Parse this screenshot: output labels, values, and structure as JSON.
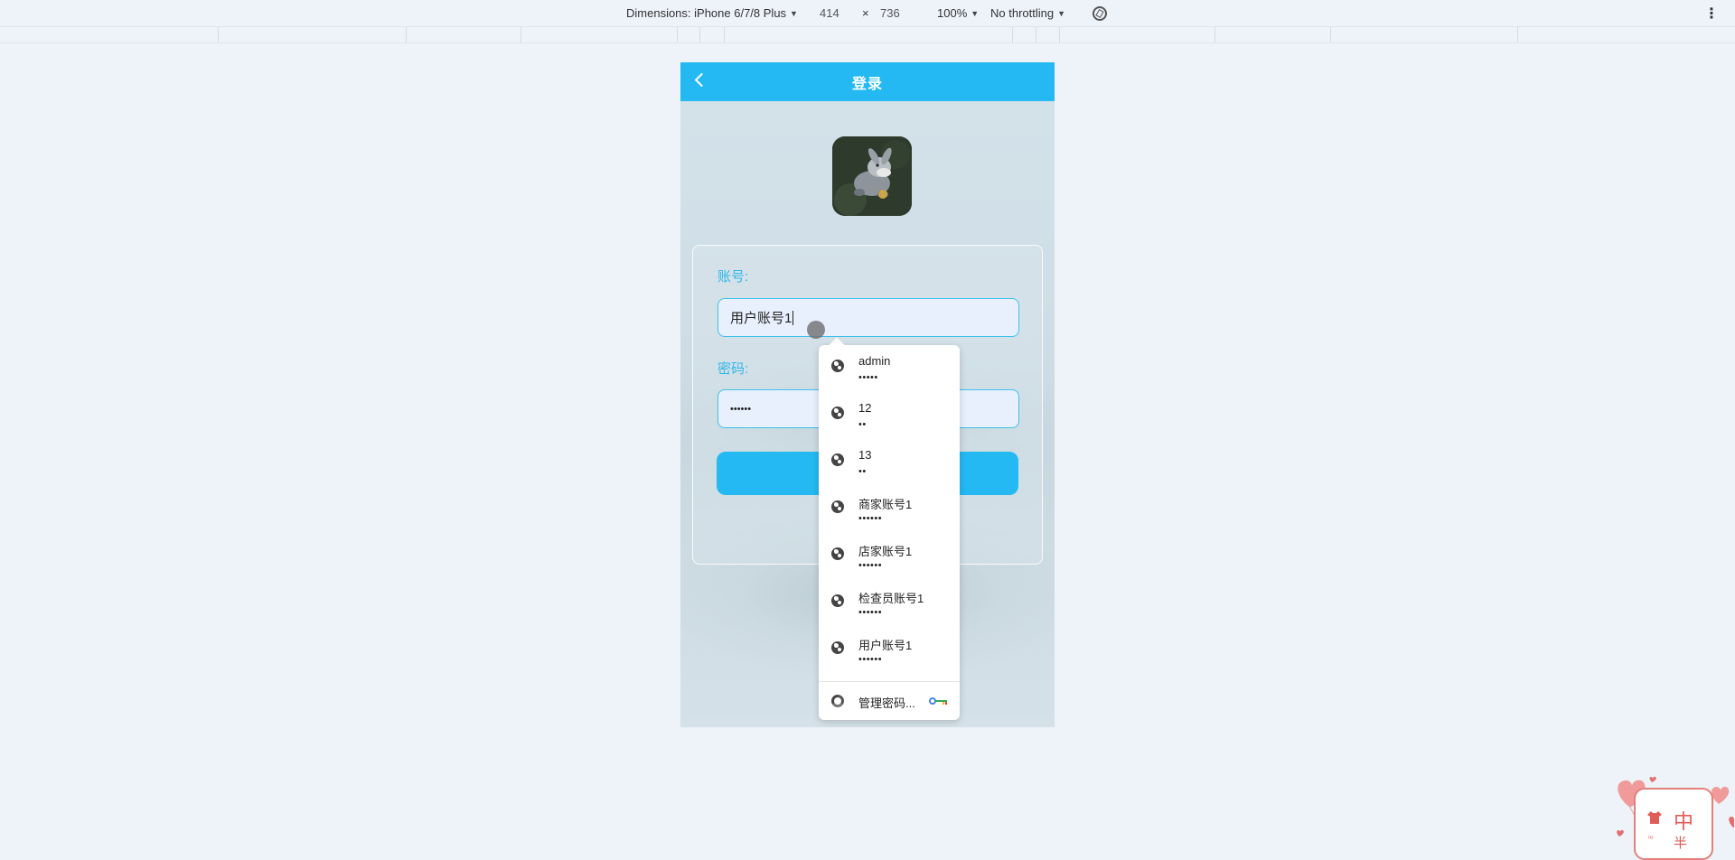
{
  "devtools": {
    "dimensions_label": "Dimensions: iPhone 6/7/8 Plus",
    "width": "414",
    "times": "×",
    "height": "736",
    "zoom": "100%",
    "throttling": "No throttling",
    "more_icon": "⋮"
  },
  "app": {
    "header_title": "登录",
    "account_label": "账号:",
    "account_value": "用户账号1",
    "password_label": "密码:",
    "password_value": "••••••"
  },
  "autofill": {
    "items": [
      {
        "username": "admin",
        "password": "•••••"
      },
      {
        "username": "12",
        "password": "••"
      },
      {
        "username": "13",
        "password": "••"
      },
      {
        "username": "商家账号1",
        "password": "••••••"
      },
      {
        "username": "店家账号1",
        "password": "••••••"
      },
      {
        "username": "检查员账号1",
        "password": "••••••"
      },
      {
        "username": "用户账号1",
        "password": "••••••"
      }
    ],
    "manage_label": "管理密码..."
  },
  "ime": {
    "char_main": "中",
    "char_sub": "半",
    "char_small": "ⁱᵒ"
  },
  "colors": {
    "accent": "#24b9f2",
    "label": "#2fb6ea",
    "input_bg": "#e8f0fe",
    "page_bg": "#eef2f9"
  }
}
